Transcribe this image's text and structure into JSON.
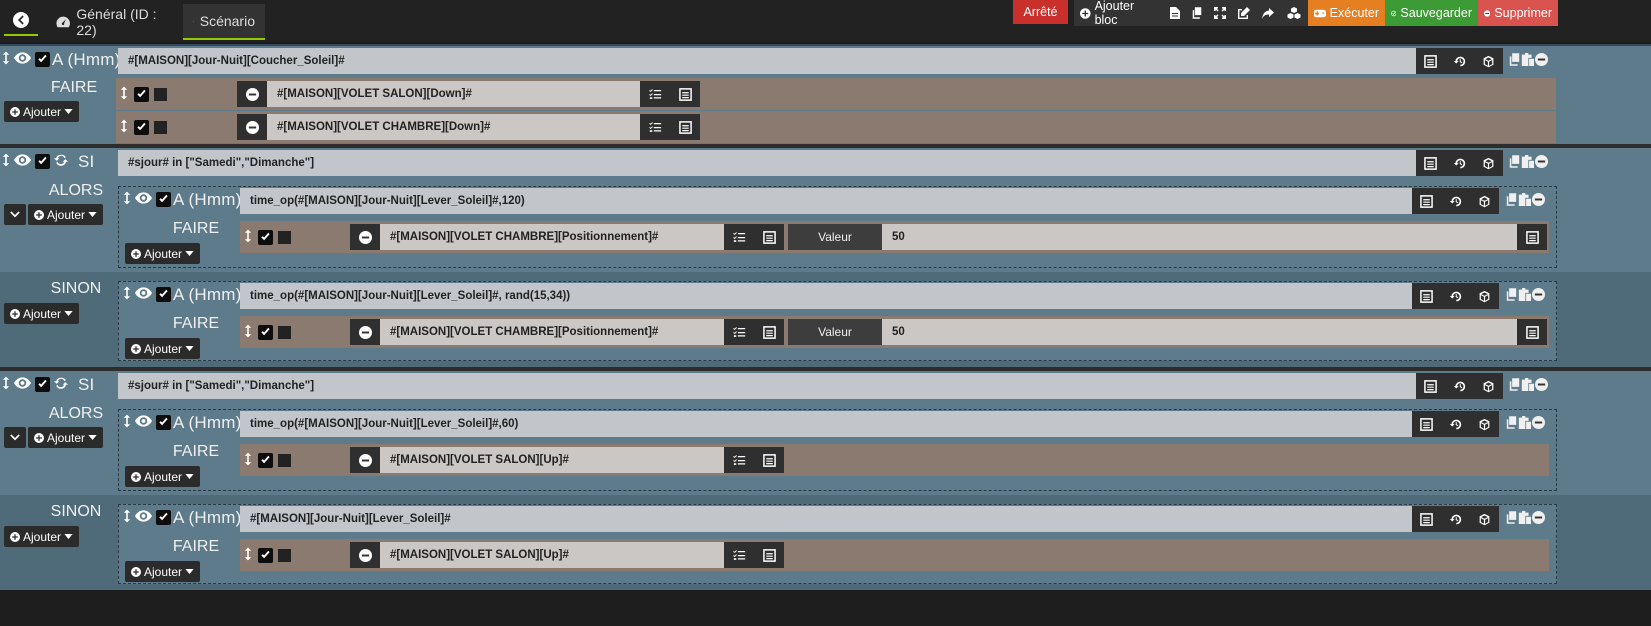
{
  "header": {
    "general_label": "Général (ID : 22)",
    "scenario_label": "Scénario"
  },
  "toolbar": {
    "state": "Arrêté",
    "add_block": "Ajouter bloc",
    "execute": "Exécuter",
    "save": "Sauvegarder",
    "delete": "Supprimer",
    "colors": {
      "state": "#c9302c",
      "execute": "#e67e22",
      "save": "#3d9b35",
      "delete": "#d9534f"
    }
  },
  "b1": {
    "kw": "A (Hmm)",
    "cond": "#[MAISON][Jour-Nuit][Coucher_Soleil]#",
    "faire": "FAIRE",
    "add": "Ajouter",
    "a1": "#[MAISON][VOLET SALON][Down]#",
    "a2": "#[MAISON][VOLET CHAMBRE][Down]#"
  },
  "b2": {
    "kw": "SI",
    "cond": "#sjour# in [\"Samedi\",\"Dimanche\"]",
    "alors": "ALORS",
    "sinon": "SINON",
    "add": "Ajouter",
    "s1": {
      "kw": "A (Hmm)",
      "cond": "time_op(#[MAISON][Jour-Nuit][Lever_Soleil]#,120)",
      "faire": "FAIRE",
      "add": "Ajouter",
      "action": "#[MAISON][VOLET CHAMBRE][Positionnement]#",
      "val_label": "Valeur",
      "val": "50"
    },
    "s2": {
      "kw": "A (Hmm)",
      "cond": "time_op(#[MAISON][Jour-Nuit][Lever_Soleil]#, rand(15,34))",
      "faire": "FAIRE",
      "add": "Ajouter",
      "action": "#[MAISON][VOLET CHAMBRE][Positionnement]#",
      "val_label": "Valeur",
      "val": "50"
    }
  },
  "b3": {
    "kw": "SI",
    "cond": "#sjour# in [\"Samedi\",\"Dimanche\"]",
    "alors": "ALORS",
    "sinon": "SINON",
    "add": "Ajouter",
    "s1": {
      "kw": "A (Hmm)",
      "cond": "time_op(#[MAISON][Jour-Nuit][Lever_Soleil]#,60)",
      "faire": "FAIRE",
      "add": "Ajouter",
      "action": "#[MAISON][VOLET SALON][Up]#"
    },
    "s2": {
      "kw": "A (Hmm)",
      "cond": "#[MAISON][Jour-Nuit][Lever_Soleil]#",
      "faire": "FAIRE",
      "add": "Ajouter",
      "action": "#[MAISON][VOLET SALON][Up]#"
    }
  }
}
